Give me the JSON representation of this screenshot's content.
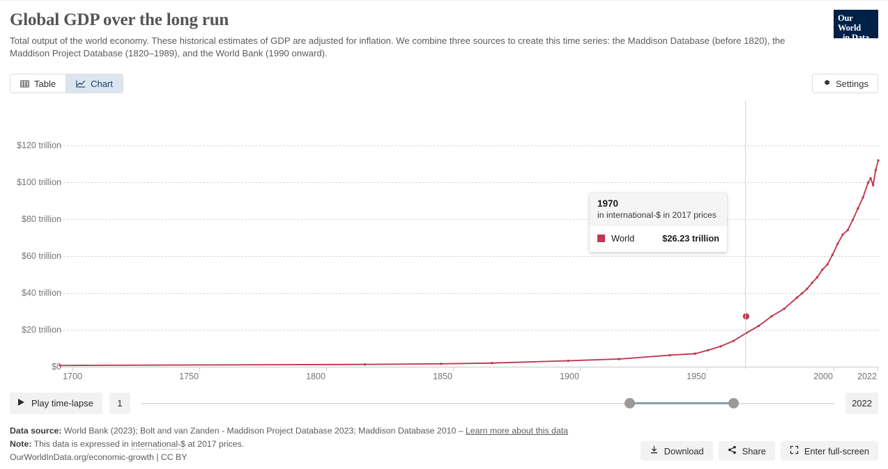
{
  "header": {
    "title": "Global GDP over the long run",
    "subtitle": "Total output of the world economy. These historical estimates of GDP are adjusted for inflation. We combine three sources to create this time series: the Maddison Database (before 1820), the Maddison Project Database (1820–1989), and the World Bank (1990 onward).",
    "logo_line1": "Our World",
    "logo_line2": "in Data"
  },
  "controls": {
    "tab_table": "Table",
    "tab_chart": "Chart",
    "active_tab": "Chart",
    "settings": "Settings"
  },
  "tooltip": {
    "year": "1970",
    "unit": "in international-$ in 2017 prices",
    "series_name": "World",
    "value": "$26.23 trillion",
    "swatch_color": "#be3a52"
  },
  "timeline": {
    "play_label": "Play time-lapse",
    "start_year": "1",
    "end_year": "2022",
    "handle_left_pct": 70.5,
    "handle_right_pct": 85.5
  },
  "footer": {
    "data_source_label": "Data source:",
    "data_source_text": "World Bank (2023); Bolt and van Zanden - Maddison Project Database 2023; Maddison Database 2010 –",
    "learn_more": "Learn more about this data",
    "note_label": "Note:",
    "note_text_a": "This data is expressed in",
    "note_dotted": "international-$",
    "note_text_b": "at 2017 prices.",
    "attribution": "OurWorldInData.org/economic-growth | CC BY",
    "download": "Download",
    "share": "Share",
    "fullscreen": "Enter full-screen"
  },
  "chart_data": {
    "type": "line",
    "title": "Global GDP over the long run",
    "subtitle": "Total output of the world economy. These historical estimates of GDP are adjusted for inflation.",
    "xlabel": "",
    "ylabel": "",
    "unit": "international-$ in 2017 prices",
    "xlim": [
      1700,
      2022
    ],
    "ylim": [
      0,
      132
    ],
    "y_ticks": [
      0,
      20,
      40,
      60,
      80,
      100,
      120
    ],
    "y_tick_labels": [
      "$0",
      "$20 trillion",
      "$40 trillion",
      "$60 trillion",
      "$80 trillion",
      "$100 trillion",
      "$120 trillion"
    ],
    "x_ticks": [
      1700,
      1750,
      1800,
      1850,
      1900,
      1950,
      2000,
      2022
    ],
    "x_tick_labels": [
      "1700",
      "1750",
      "1800",
      "1850",
      "1900",
      "1950",
      "2000",
      "2022"
    ],
    "grid": true,
    "legend": "none",
    "series": [
      {
        "name": "World",
        "color": "#be3a52",
        "x": [
          1700,
          1820,
          1850,
          1870,
          1900,
          1920,
          1940,
          1950,
          1955,
          1960,
          1965,
          1970,
          1975,
          1980,
          1985,
          1990,
          1992,
          1994,
          1996,
          1998,
          2000,
          2002,
          2004,
          2006,
          2008,
          2010,
          2012,
          2014,
          2016,
          2018,
          2019,
          2020,
          2021,
          2022
        ],
        "y": [
          0.67,
          1.2,
          1.5,
          1.9,
          3.1,
          4.0,
          6.0,
          6.8,
          8.6,
          10.6,
          13.4,
          17.5,
          21.3,
          26.23,
          30.2,
          36.0,
          38.2,
          40.6,
          43.8,
          46.6,
          50.5,
          53.3,
          58.3,
          64.0,
          68.8,
          71.2,
          76.6,
          82.5,
          88.2,
          95.9,
          98.2,
          94.6,
          102.5,
          107.5
        ],
        "highlight_point": {
          "x": 1970,
          "y": 26.23,
          "label": "$26.23 trillion"
        }
      }
    ]
  }
}
